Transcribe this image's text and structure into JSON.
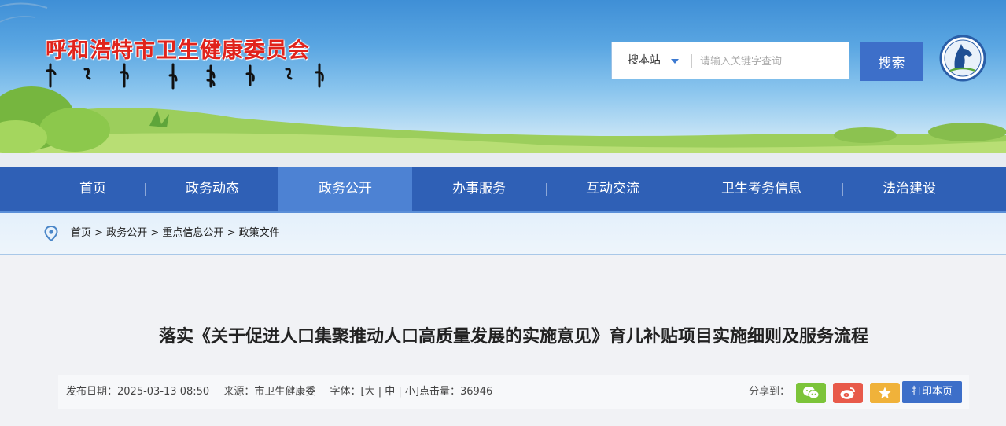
{
  "header": {
    "site_title": "呼和浩特市卫生健康委员会"
  },
  "search": {
    "scope": "搜本站",
    "placeholder": "请输入关键字查询",
    "button": "搜索"
  },
  "nav": {
    "items": [
      {
        "label": "首页"
      },
      {
        "label": "政务动态"
      },
      {
        "label": "政务公开"
      },
      {
        "label": "办事服务"
      },
      {
        "label": "互动交流"
      },
      {
        "label": "卫生考务信息"
      },
      {
        "label": "法治建设"
      }
    ],
    "active": "政务公开"
  },
  "breadcrumb": {
    "items": [
      "首页",
      "政务公开",
      "重点信息公开",
      "政策文件"
    ],
    "separator": ">"
  },
  "article": {
    "title": "落实《关于促进人口集聚推动人口高质量发展的实施意见》育儿补贴项目实施细则及服务流程",
    "publish_label": "发布日期：",
    "publish_date": "2025-03-13 08:50",
    "source_label": "来源：",
    "source": "市卫生健康委",
    "font_label": "字体：",
    "font_sizes": "[大 | 中 | 小]",
    "clicks_label": "点击量：",
    "clicks": "36946"
  },
  "share": {
    "label": "分享到：",
    "buttons": [
      {
        "icon": "wechat-icon",
        "color": "#7cc43a"
      },
      {
        "icon": "weibo-icon",
        "color": "#e85a4a"
      },
      {
        "icon": "star-icon",
        "color": "#f0b23a"
      }
    ],
    "print": "打印本页"
  },
  "colors": {
    "title_red": "#e0231c",
    "nav_blue": "#2f60b6",
    "nav_active": "#4d82d3",
    "button_blue": "#3d6fc9"
  }
}
